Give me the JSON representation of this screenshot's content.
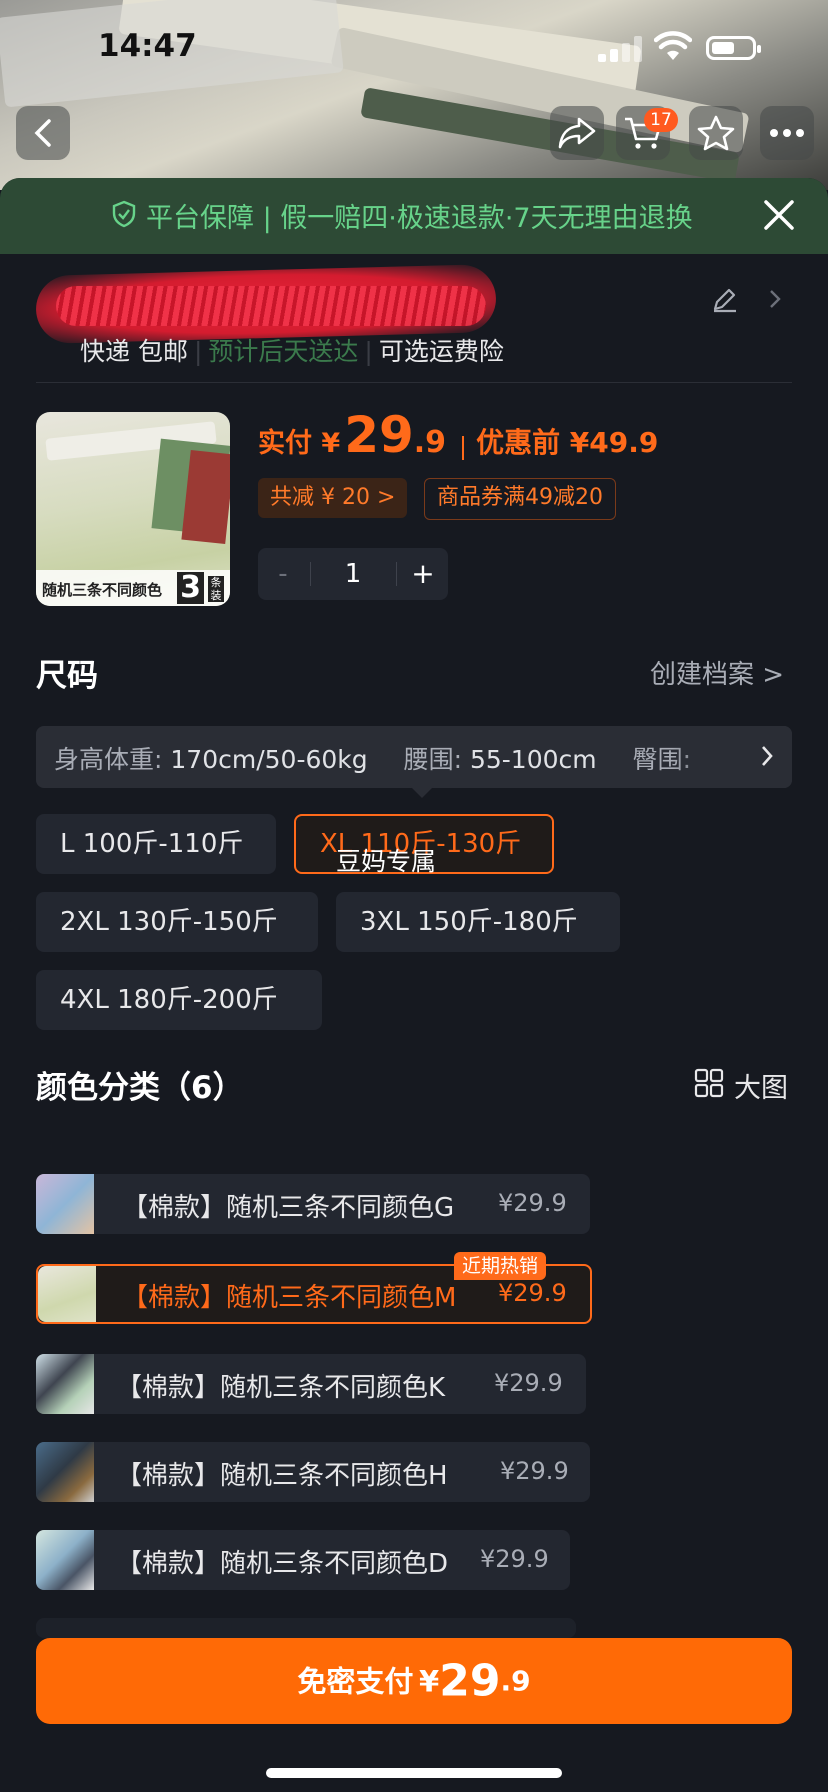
{
  "status_bar": {
    "time": "14:47"
  },
  "nav": {
    "cart_badge": "17"
  },
  "guarantee": {
    "text": "平台保障 | 假一赔四·极速退款·7天无理由退换"
  },
  "shipping": {
    "parts": [
      "快递 包邮",
      "预计后天送达",
      "可选运费险"
    ]
  },
  "product": {
    "thumbnail_caption": "随机三条不同颜色",
    "thumbnail_count": "3",
    "thumbnail_unit": "条装",
    "price_label": "实付 ¥",
    "price_int": "29",
    "price_dec": ".9",
    "before_label": "优惠前 ¥49.9",
    "discount_tag": "共减 ¥ 20 >",
    "coupon_tag": "商品券满49减20",
    "quantity": "1",
    "minus": "-",
    "plus": "+"
  },
  "size": {
    "title": "尺码",
    "link": "创建档案 >",
    "measure_label_1": "身高体重:",
    "measure_value_1": "170cm/50-60kg",
    "measure_label_2": "腰围:",
    "measure_value_2": "55-100cm",
    "measure_label_3": "臀围:",
    "options": [
      "L 100斤-110斤",
      "XL 110斤-130斤",
      "2XL 130斤-150斤",
      "3XL 150斤-180斤",
      "4XL 180斤-200斤"
    ],
    "selected": "XL 110斤-130斤",
    "overlay_text": "豆妈专属"
  },
  "colors": {
    "title": "颜色分类（6）",
    "view_toggle": "大图",
    "hot_badge": "近期热销",
    "items": [
      {
        "name": "【棉款】随机三条不同颜色G",
        "price": "¥29.9"
      },
      {
        "name": "【棉款】随机三条不同颜色M",
        "price": "¥29.9"
      },
      {
        "name": "【棉款】随机三条不同颜色K",
        "price": "¥29.9"
      },
      {
        "name": "【棉款】随机三条不同颜色H",
        "price": "¥29.9"
      },
      {
        "name": "【棉款】随机三条不同颜色D",
        "price": "¥29.9"
      }
    ]
  },
  "pay": {
    "label": "免密支付",
    "currency": "¥",
    "int": "29",
    "dec": ".9"
  },
  "colors_palette": {
    "accent": "#ff6a06",
    "guarantee_green": "#67d38a",
    "sheet_bg": "#161920"
  }
}
